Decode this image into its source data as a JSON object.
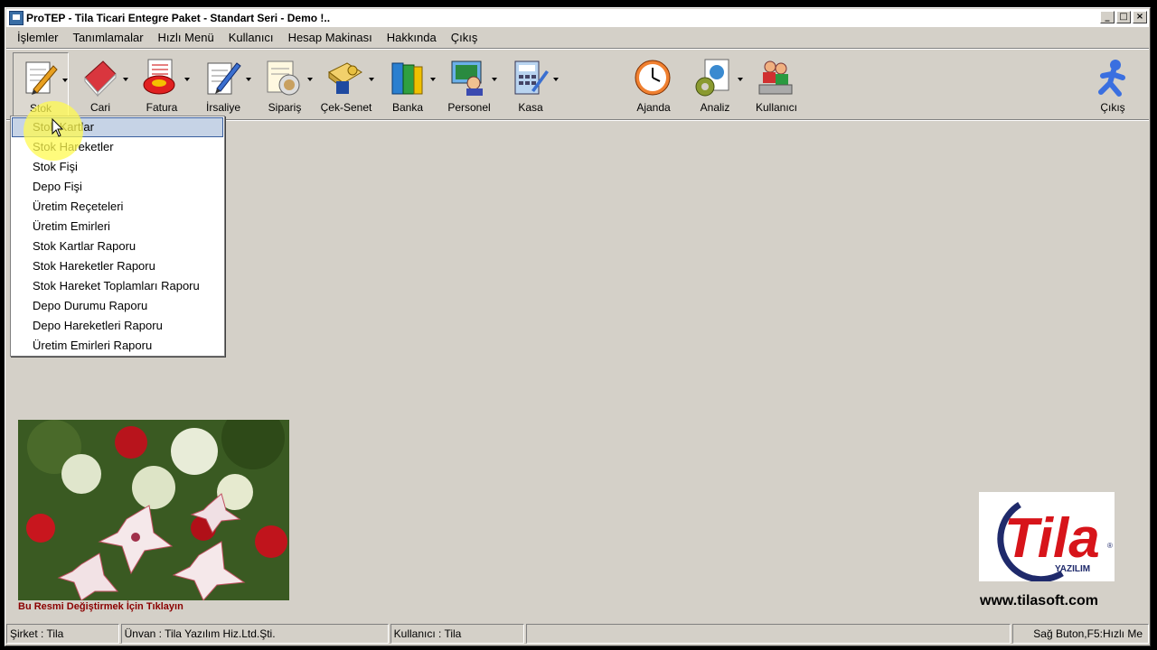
{
  "window": {
    "title": "ProTEP - Tila Ticari Entegre Paket - Standart Seri - Demo !..",
    "minimize_label": "_",
    "maximize_label": "□",
    "close_label": "×"
  },
  "menubar": {
    "items": [
      {
        "label": "İşlemler"
      },
      {
        "label": "Tanımlamalar"
      },
      {
        "label": "Hızlı Menü"
      },
      {
        "label": "Kullanıcı"
      },
      {
        "label": "Hesap Makinası"
      },
      {
        "label": "Hakkında"
      },
      {
        "label": "Çıkış"
      }
    ]
  },
  "toolbar": {
    "items": [
      {
        "label": "Stok",
        "icon": "stock-pencil-icon"
      },
      {
        "label": "Cari",
        "icon": "book-icon"
      },
      {
        "label": "Fatura",
        "icon": "invoice-icon"
      },
      {
        "label": "İrsaliye",
        "icon": "pen-document-icon"
      },
      {
        "label": "Sipariş",
        "icon": "order-document-icon"
      },
      {
        "label": "Çek-Senet",
        "icon": "check-book-icon"
      },
      {
        "label": "Banka",
        "icon": "bank-books-icon"
      },
      {
        "label": "Personel",
        "icon": "personnel-icon"
      },
      {
        "label": "Kasa",
        "icon": "calculator-icon"
      },
      {
        "label": "Ajanda",
        "icon": "clock-icon"
      },
      {
        "label": "Analiz",
        "icon": "analysis-gear-icon"
      },
      {
        "label": "Kullanıcı",
        "icon": "users-icon"
      },
      {
        "label": "Çıkış",
        "icon": "running-man-icon"
      }
    ]
  },
  "stok_menu": {
    "items": [
      {
        "label": "Stok Kartlar"
      },
      {
        "label": "Stok Hareketler"
      },
      {
        "label": "Stok Fişi"
      },
      {
        "label": "Depo Fişi"
      },
      {
        "label": "Üretim Reçeteleri"
      },
      {
        "label": "Üretim Emirleri"
      },
      {
        "label": "Stok Kartlar Raporu"
      },
      {
        "label": "Stok Hareketler Raporu"
      },
      {
        "label": "Stok Hareket Toplamları Raporu"
      },
      {
        "label": "Depo Durumu Raporu"
      },
      {
        "label": "Depo Hareketleri Raporu"
      },
      {
        "label": "Üretim Emirleri Raporu"
      }
    ],
    "selected_index": 0
  },
  "desktop": {
    "photo_caption": "Bu Resmi Değiştirmek İçin Tıklayın",
    "logo_word": "Tila",
    "logo_subtext": "YAZILIM",
    "logo_registered": "®",
    "website": "www.tilasoft.com"
  },
  "statusbar": {
    "company": "Şirket : Tila",
    "title": "Ünvan : Tila Yazılım Hiz.Ltd.Şti.",
    "user": "Kullanıcı : Tila",
    "empty": "",
    "hint": "Sağ Buton,F5:Hızlı Me"
  },
  "colors": {
    "window_bg": "#d4d0c8",
    "selection": "#c6d3e6",
    "logo_red": "#d7141a",
    "logo_navy": "#1f2a6b",
    "caption_red": "#8b0000"
  }
}
